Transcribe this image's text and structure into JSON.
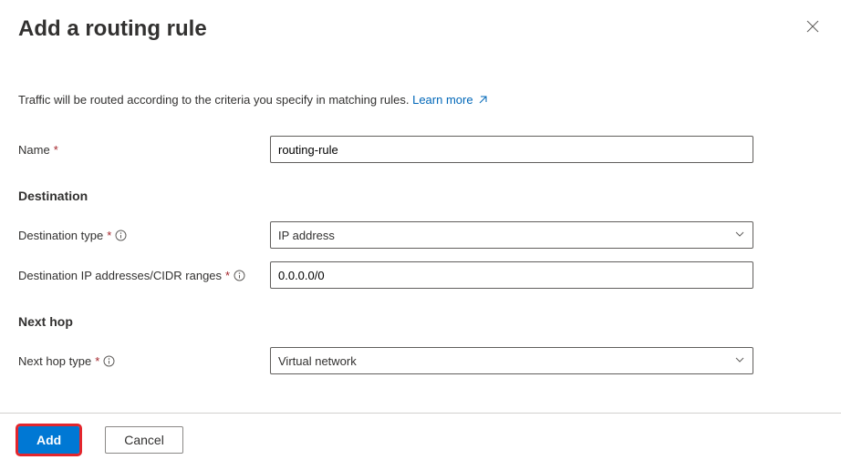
{
  "header": {
    "title": "Add a routing rule"
  },
  "intro": {
    "text": "Traffic will be routed according to the criteria you specify in matching rules. ",
    "link_text": "Learn more"
  },
  "fields": {
    "name": {
      "label": "Name",
      "value": "routing-rule"
    },
    "destination_section": "Destination",
    "destination_type": {
      "label": "Destination type",
      "value": "IP address"
    },
    "destination_cidr": {
      "label": "Destination IP addresses/CIDR ranges",
      "value": "0.0.0.0/0"
    },
    "nexthop_section": "Next hop",
    "nexthop_type": {
      "label": "Next hop type",
      "value": "Virtual network"
    }
  },
  "footer": {
    "add_label": "Add",
    "cancel_label": "Cancel"
  }
}
